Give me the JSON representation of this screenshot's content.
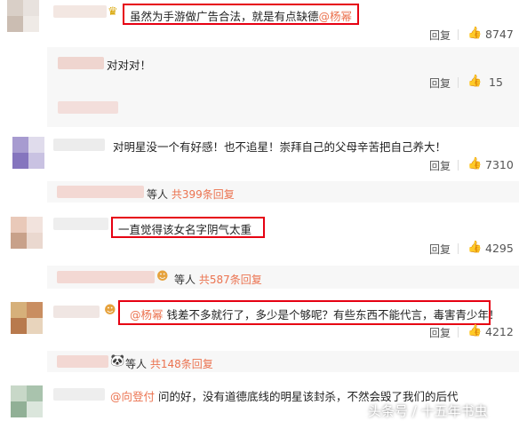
{
  "comments": [
    {
      "text": "虽然为手游做广告合法，就是有点缺德",
      "mention": "@杨幂",
      "reply": "回复",
      "likes": "8747"
    },
    {
      "text": "对对对！",
      "reply": "回复",
      "likes": "15"
    },
    {
      "text": "对明星没一个有好感！也不追星！崇拜自己的父母辛苦把自己养大！",
      "reply": "回复",
      "likes": "7310"
    },
    {
      "text": "一直觉得该女名字阴气太重",
      "reply": "回复",
      "likes": "4295"
    },
    {
      "mention": "@杨幂",
      "text": " 钱差不多就行了，多少是个够呢？有些东西不能代言，毒害青少年！",
      "reply": "回复",
      "likes": "4212"
    },
    {
      "mention": "@向登付",
      "text": " 问的好，没有道德底线的明星该封杀，不然会毁了我们的后代"
    }
  ],
  "more_replies": [
    {
      "prefix": "等人",
      "link": "共399条回复"
    },
    {
      "prefix": "等人",
      "link": "共587条回复"
    },
    {
      "prefix": "等人",
      "link": "共148条回复"
    }
  ],
  "watermark": "头条号 / 十五年书虫",
  "colors": {
    "accent": "#eb7350",
    "highlight_box": "#e60012"
  },
  "icons": {
    "like": "thumbs-up-icon",
    "badge": "crown-icon",
    "emoji_face": "face-icon",
    "panda": "panda-icon"
  }
}
